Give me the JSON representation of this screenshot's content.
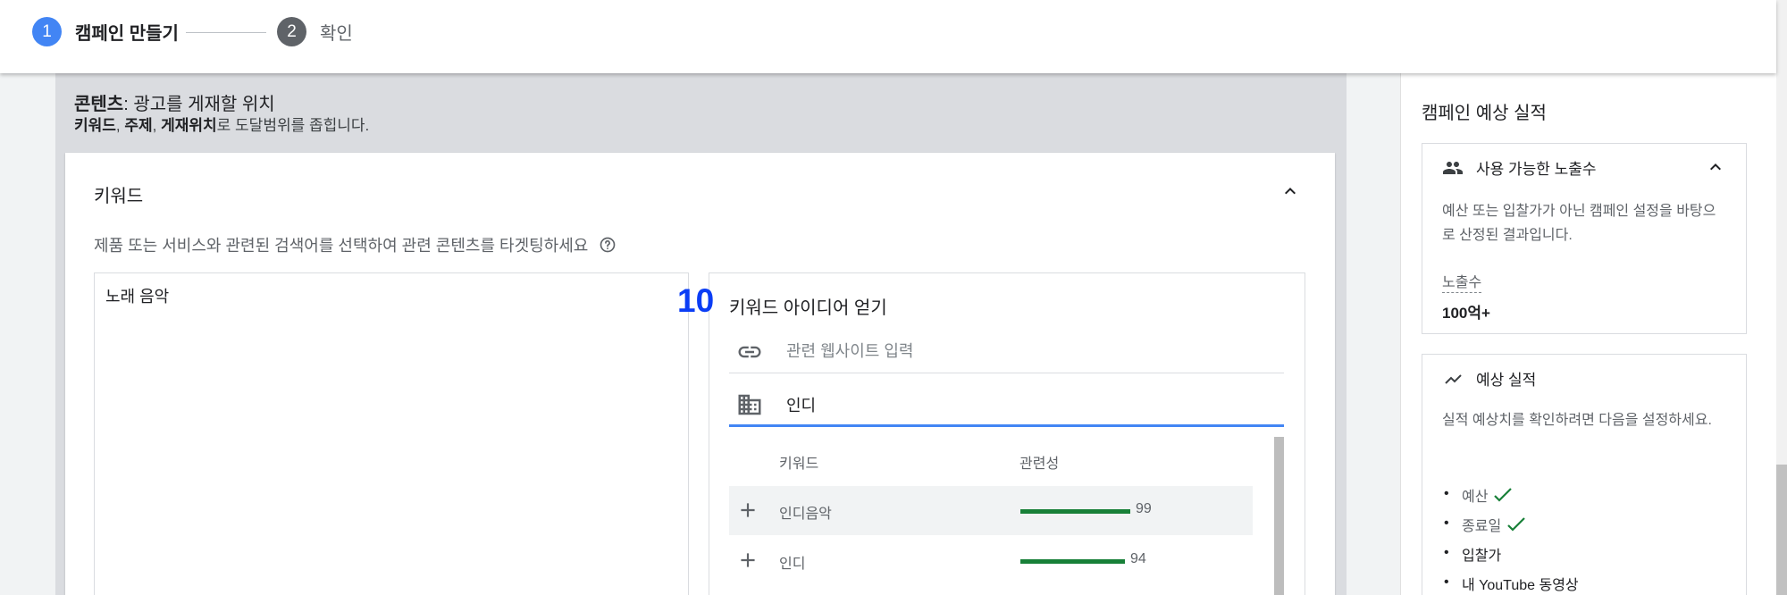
{
  "stepper": {
    "step1": {
      "number": "1",
      "label": "캠페인 만들기"
    },
    "step2": {
      "number": "2",
      "label": "확인"
    }
  },
  "content_section": {
    "title_bold": "콘텐츠",
    "title_rest": ": 광고를 게재할 위치",
    "sub_bold1": "키워드",
    "sub_sep1": ", ",
    "sub_bold2": "주제",
    "sub_sep2": ", ",
    "sub_bold3": "게재위치",
    "sub_rest": "로 도달범위를 좁힙니다."
  },
  "keywords_card": {
    "title": "키워드",
    "description": "제품 또는 서비스와 관련된 검색어를 선택하여 관련 콘텐츠를 타겟팅하세요",
    "textarea_value": "노래 음악"
  },
  "ideas_panel": {
    "marker": "10",
    "title": "키워드 아이디어 얻기",
    "website_placeholder": "관련 웹사이트 입력",
    "product_value": "인디",
    "columns": {
      "keyword": "키워드",
      "relevance": "관련성"
    },
    "rows": [
      {
        "keyword": "인디음악",
        "relevance": 99
      },
      {
        "keyword": "인디",
        "relevance": 94
      }
    ]
  },
  "sidebar": {
    "title": "캠페인 예상 실적",
    "impressions_card": {
      "heading": "사용 가능한 노출수",
      "note": "예산 또는 입찰가가 아닌 캠페인 설정을 바탕으로 산정된 결과입니다.",
      "metric_label": "노출수",
      "metric_value": "100억+"
    },
    "performance_card": {
      "heading": "예상 실적",
      "note": "실적 예상치를 확인하려면 다음을 설정하세요.",
      "requirements": [
        {
          "label": "예산",
          "done": true
        },
        {
          "label": "종료일",
          "done": true
        },
        {
          "label": "입찰가",
          "done": false
        },
        {
          "label": "내 YouTube 동영상",
          "done": false
        }
      ]
    }
  },
  "colors": {
    "accent_blue": "#4285f4",
    "relevance_green": "#188038",
    "check_green": "#188038",
    "marker_blue": "#0b3df5"
  }
}
